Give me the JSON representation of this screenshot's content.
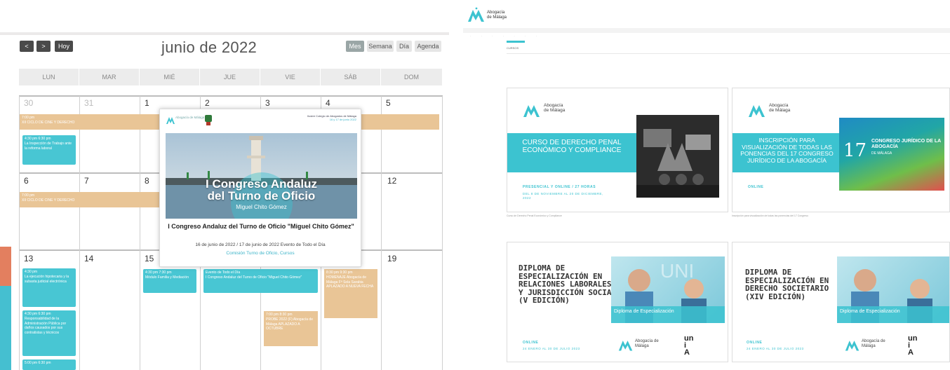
{
  "calendar": {
    "nav": {
      "prev": "<",
      "next": ">",
      "today": "Hoy"
    },
    "title": "junio de 2022",
    "views": {
      "month": "Mes",
      "week": "Semana",
      "day": "Día",
      "agenda": "Agenda"
    },
    "weekdays": [
      "LUN",
      "MAR",
      "MIÉ",
      "JUE",
      "VIE",
      "SÁB",
      "DOM"
    ],
    "days": {
      "w1": [
        "30",
        "31",
        "1",
        "2",
        "3",
        "4",
        "5"
      ],
      "w2": [
        "6",
        "7",
        "8",
        "12"
      ],
      "w3": [
        "13",
        "14",
        "15",
        "19"
      ]
    },
    "events": {
      "e1": "7:00 pm\nXII CICLO DE CINE Y DERECHO",
      "e2": "4:30 pm 6:30 pm\nLa Inspección de Trabajo ante la reforma laboral",
      "e3": "7:00 pm\nXII CICLO DE CINE Y DERECHO",
      "e4": "4:30 pm\nLa ejecución hipotecaria y la subasta judicial electrónica",
      "e5": "4:30 pm 6:30 pm\nResponsabilidad de la Administración Pública por daños causados por sus contratistas y técnicos",
      "e6": "5:00 pm 6:30 pm",
      "e7": "4:30 pm 7:30 pm\nMódulo Familia y Mediación",
      "e8": "Evento de Todo el Día\nI Congreso Andaluz del Turno de Oficio \"Miguel Chito Gómez\"",
      "e9": "7:00 pm 8:30 pm\nPROBE 2022 (F) Abogacía de Málaga APLAZADO A OCTUBRE",
      "e10": "8:30 pm 9:30 pm\nHOMENAJE Abogacía de Málaga Fª Sola Sarabia APLAZADO A NUEVA FECHA"
    },
    "popup": {
      "org_small": "Abogacía de Málaga",
      "org_right": "Ilustre Colegio de Abogados de Málaga",
      "dates_small": "16 y 17 de junio 2022",
      "photo_title_1": "I Congreso Andaluz",
      "photo_title_2": "del Turno de Oficio",
      "photo_sub": "Miguel Chito Gómez",
      "title": "I Congreso Andaluz del Turno de Oficio \"Miguel Chito Gómez\"",
      "date": "16 de junio de 2022 / 17 de junio de 2022 Evento de Todo el Día",
      "category": "Comisión Turno de Oficio, Cursos"
    }
  },
  "catalog": {
    "brand": "Abogacía de Málaga",
    "section": "CURSOS",
    "cards": [
      {
        "logo": "Abogacía de Málaga",
        "band": "CURSO DE DERECHO PENAL ECONÓMICO Y COMPLIANCE",
        "tag": "PRESENCIAL Y ONLINE / 27 HORAS",
        "date": "DEL 8 DE NOVIEMBRE AL 20 DE DICIEMBRE, 2022",
        "caption": "Curso de Derecho Penal Económico y Compliance"
      },
      {
        "logo": "Abogacía de Málaga",
        "band": "INSCRIPCIÓN PARA VISUALIZACIÓN DE TODAS LAS PONENCIAS DEL 17 CONGRESO JURÍDICO DE LA ABOGACÍA",
        "tag": "ONLINE",
        "promo_num": "17",
        "promo_text": "CONGRESO JURÍDICO DE LA ABOGACÍA",
        "promo_sub": "DE MÁLAGA",
        "caption": "Inscripción para visualización de todas las ponencias del 17 Congreso"
      },
      {
        "title": "DIPLOMA DE ESPECIALIZACIÓN EN RELACIONES LABORALES Y JURISDICCIÓN SOCIAL (V EDICIÓN)",
        "tag": "ONLINE",
        "date": "24 ENERO AL 30 DE JULIO 2023",
        "promo": "Diploma de Especialización",
        "logo": "Abogacía de Málaga",
        "uni": "un\ni\nA"
      },
      {
        "title": "DIPLOMA DE ESPECIALIZACIÓN EN DERECHO SOCIETARIO (XIV EDICIÓN)",
        "tag": "ONLINE",
        "date": "24 ENERO AL 30 DE JULIO 2023",
        "promo": "Diploma de Especialización",
        "logo": "Abogacía de Málaga",
        "uni": "un\ni\nA"
      }
    ]
  },
  "colors": {
    "teal": "#3cc3d0",
    "orange_event": "#e9c596",
    "accent_red": "#e37f5f"
  }
}
